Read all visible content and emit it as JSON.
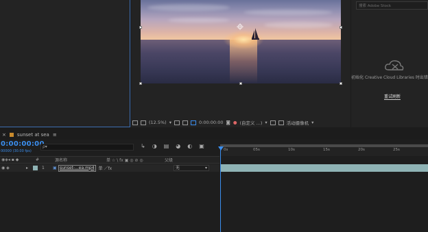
{
  "viewer": {
    "zoom": "(12.5%)",
    "timecode": "0:00:00:00",
    "view_mode": "(自定义 ...)",
    "renderer": "活动摄像机"
  },
  "libraries": {
    "search_placeholder": "搜索 Adobe Stock",
    "message": "初始化 Creative Cloud Libraries 时出错",
    "refresh_label": "重试刷新"
  },
  "timeline": {
    "comp_name": "sunset at sea",
    "menu_icon": "≡",
    "current_time": "0:00:00:00",
    "fps_label": "00000 (30.00 fps)",
    "search_icon": "ρ▾",
    "columns": {
      "num": "#",
      "source_name": "源名称",
      "switches": "单 ☆ \\ fx ▣ ◎ ⊘ ◎",
      "parent": "父级"
    },
    "layer": {
      "index": "1",
      "name": "sunset-...ea.mp4",
      "parent_value": "无",
      "switches": "单 ／fx"
    },
    "ruler_ticks": [
      "0s",
      "05s",
      "10s",
      "15s",
      "20s",
      "25s"
    ]
  },
  "colors": {
    "accent": "#3b8ff0",
    "track": "#8fb3b5",
    "panel": "#232323"
  }
}
